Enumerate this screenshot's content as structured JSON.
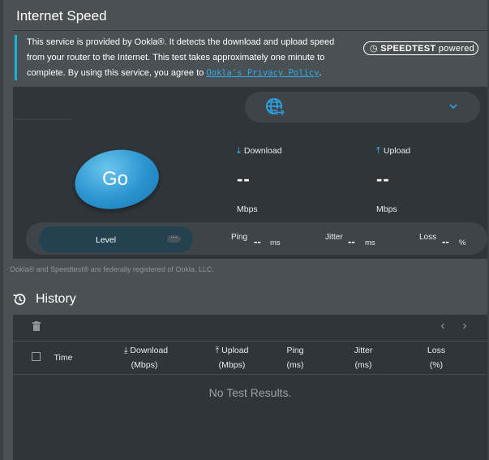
{
  "title": "Internet Speed",
  "info": {
    "text": "This service is provided by Ookla®. It detects the download and upload speed from your router to the Internet. This test takes approximately one minute to complete. By using this service, you agree to",
    "link": "Ookla's Privacy Policy",
    "after_link": "."
  },
  "badge": {
    "brand": "SPEEDTEST",
    "suffix": "powered"
  },
  "colors": {
    "accent": "#19b0e0",
    "go_button": "#2a93cf",
    "panel": "#2f3538",
    "link": "#2ea8e6"
  },
  "server_select": {
    "icon": "globe-link-icon",
    "value": ""
  },
  "go_button": {
    "label": "Go"
  },
  "download": {
    "label": "Download",
    "value": "--",
    "unit": "Mbps"
  },
  "upload": {
    "label": "Upload",
    "value": "--",
    "unit": "Mbps"
  },
  "level": {
    "label": "Level",
    "more": "···"
  },
  "ping": {
    "label": "Ping",
    "value": "--",
    "unit": "ms"
  },
  "jitter": {
    "label": "Jitter",
    "value": "--",
    "unit": "ms"
  },
  "loss": {
    "label": "Loss",
    "value": "--",
    "unit": "%"
  },
  "legal": "Ookla® and Speedtest® are federally registered of Ookla, LLC.",
  "history": {
    "title": "History",
    "columns": [
      {
        "label": "Time",
        "sub": ""
      },
      {
        "label": "Download",
        "sub": "(Mbps)"
      },
      {
        "label": "Upload",
        "sub": "(Mbps)"
      },
      {
        "label": "Ping",
        "sub": "(ms)"
      },
      {
        "label": "Jitter",
        "sub": "(ms)"
      },
      {
        "label": "Loss",
        "sub": "(%)"
      }
    ],
    "empty": "No Test Results.",
    "pager_prev": "‹",
    "pager_next": "›"
  }
}
